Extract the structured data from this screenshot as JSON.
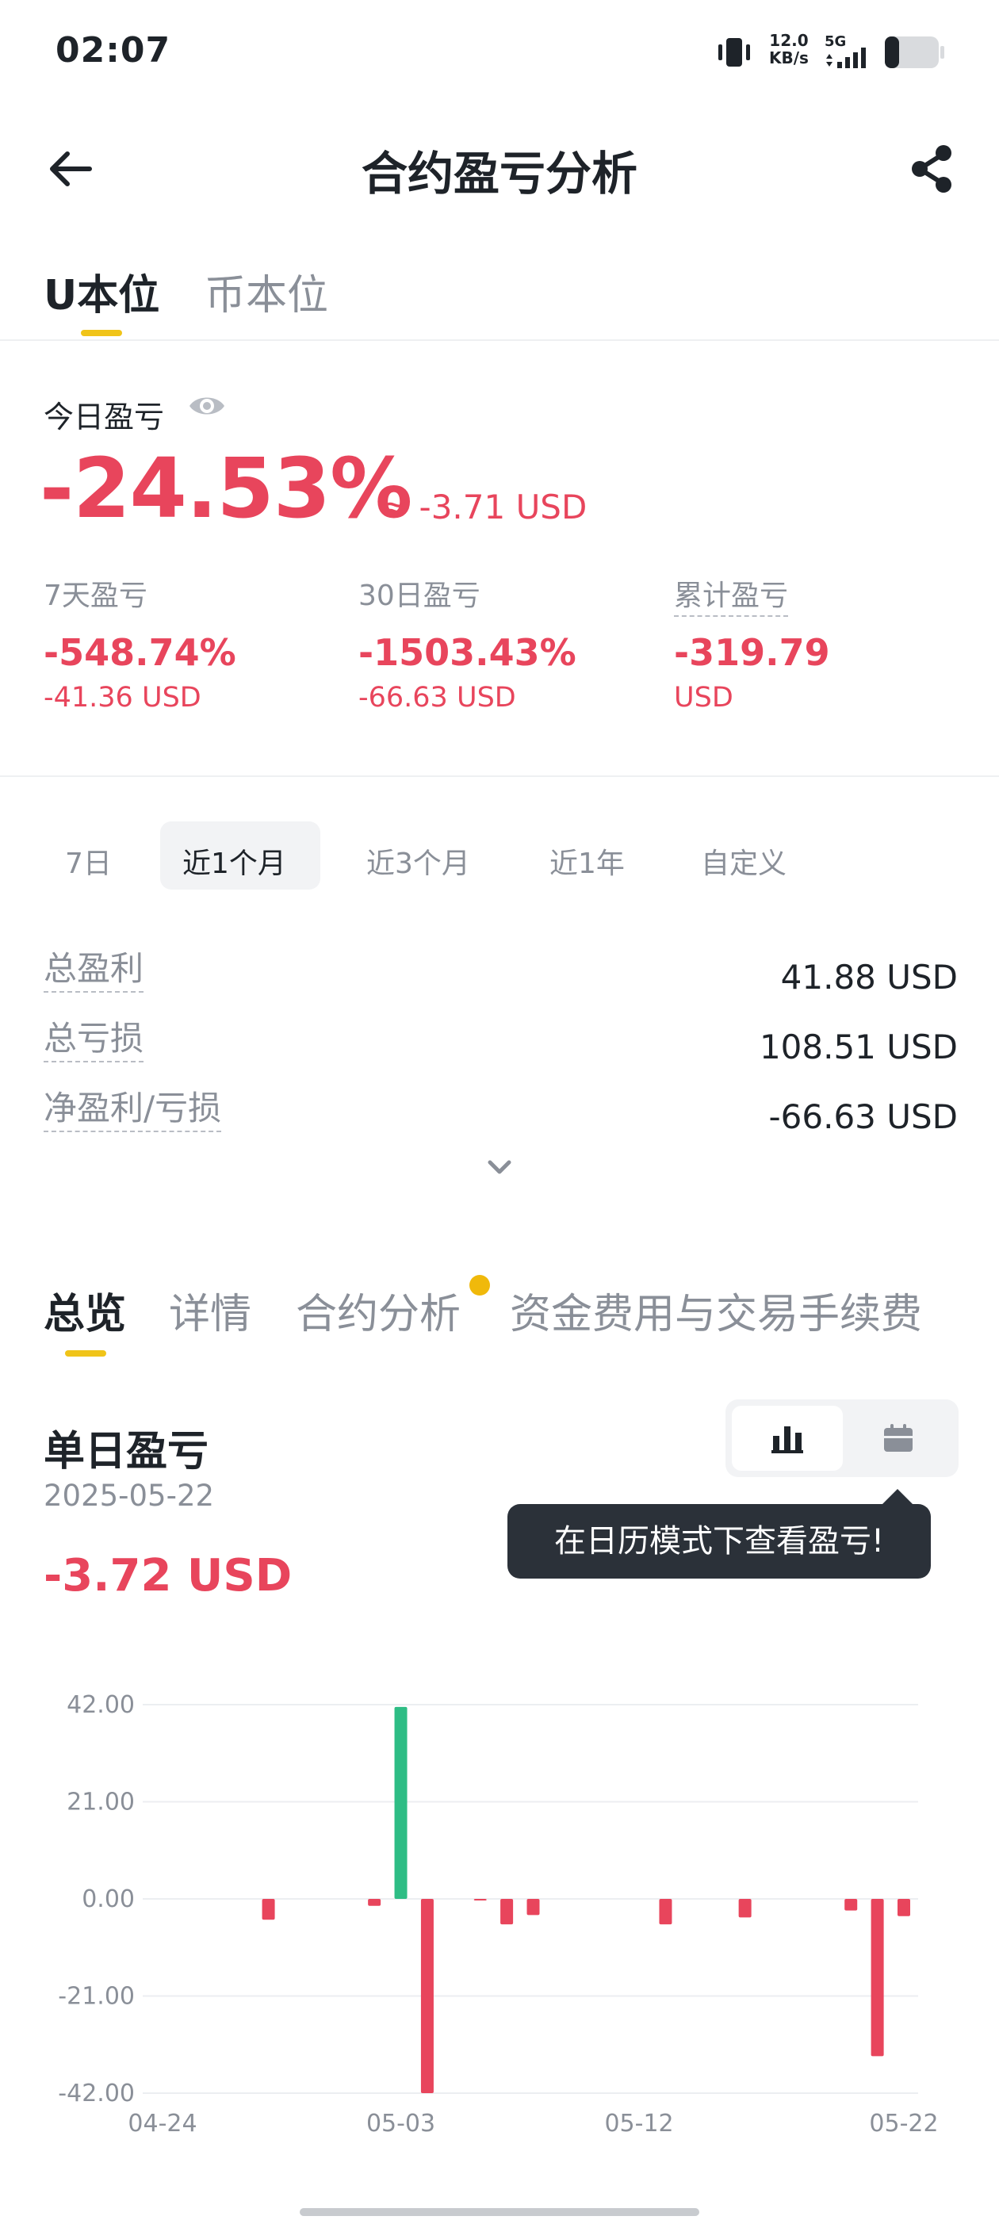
{
  "status_bar": {
    "time": "02:07",
    "net_speed": "12.0",
    "net_unit": "KB/s",
    "network": "5G"
  },
  "header": {
    "title": "合约盈亏分析",
    "back_icon": "arrow-left-icon",
    "share_icon": "share-icon"
  },
  "unit_tabs": [
    "U本位",
    "币本位"
  ],
  "today": {
    "label": "今日盈亏",
    "percent": "-24.53%",
    "usd": "≈ -3.71 USD"
  },
  "stats": [
    {
      "label": "7天盈亏",
      "value": "-548.74%",
      "sub": "-41.36 USD"
    },
    {
      "label": "30日盈亏",
      "value": "-1503.43%",
      "sub": "-66.63 USD"
    },
    {
      "label": "累计盈亏",
      "value": "-319.79",
      "sub": "USD"
    }
  ],
  "periods": [
    "7日",
    "近1个月",
    "近3个月",
    "近1年",
    "自定义"
  ],
  "summary": [
    {
      "label": "总盈利",
      "value": "41.88 USD"
    },
    {
      "label": "总亏损",
      "value": "108.51 USD"
    },
    {
      "label": "净盈利/亏损",
      "value": "-66.63 USD"
    }
  ],
  "section_tabs": [
    "总览",
    "详情",
    "合约分析",
    "资金费用与交易手续费"
  ],
  "daily": {
    "title": "单日盈亏",
    "date": "2025-05-22",
    "value": "-3.72 USD"
  },
  "tooltip": "在日历模式下查看盈亏!",
  "colors": {
    "loss": "#e8455c",
    "profit": "#2ebd85",
    "accent": "#f0c419"
  },
  "chart_data": {
    "type": "bar",
    "x_labels": [
      "04-24",
      "05-03",
      "05-12",
      "05-22"
    ],
    "y_ticks": [
      "42.00",
      "21.00",
      "0.00",
      "-21.00",
      "-42.00"
    ],
    "ylim": [
      -42,
      42
    ],
    "grid": true,
    "days": [
      "04-24",
      "04-25",
      "04-26",
      "04-27",
      "04-28",
      "04-29",
      "04-30",
      "05-01",
      "05-02",
      "05-03",
      "05-04",
      "05-05",
      "05-06",
      "05-07",
      "05-08",
      "05-09",
      "05-10",
      "05-11",
      "05-12",
      "05-13",
      "05-14",
      "05-15",
      "05-16",
      "05-17",
      "05-18",
      "05-19",
      "05-20",
      "05-21",
      "05-22"
    ],
    "values": [
      0,
      0,
      0,
      0,
      -4.5,
      0,
      0,
      0,
      -1.5,
      41.5,
      -42,
      0,
      -0.3,
      -5.5,
      -3.5,
      0,
      0,
      0,
      0,
      -5.5,
      0,
      0,
      -4,
      0,
      0,
      0,
      -2.5,
      -34,
      -3.72
    ]
  }
}
